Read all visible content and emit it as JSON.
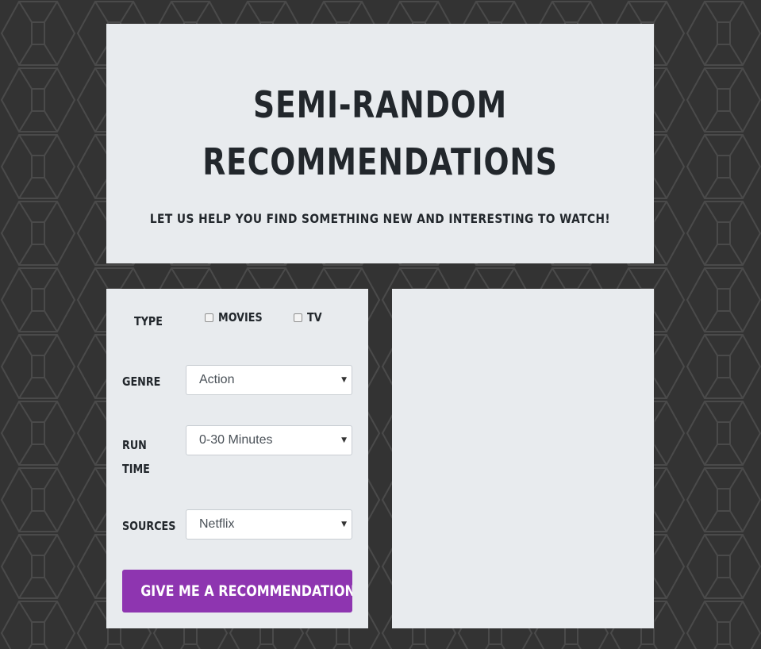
{
  "header": {
    "title_line1": "Semi-Random",
    "title_line2": "Recommendations",
    "subtitle": "Let us help you find something new and interesting to watch!"
  },
  "form": {
    "type": {
      "label": "Type",
      "options": [
        {
          "label": "Movies",
          "checked": false
        },
        {
          "label": "TV",
          "checked": false
        }
      ]
    },
    "genre": {
      "label": "Genre",
      "value": "Action"
    },
    "runtime": {
      "label_line1": "Run",
      "label_line2": "Time",
      "value": "0-30 Minutes"
    },
    "sources": {
      "label": "Sources",
      "value": "Netflix"
    },
    "submit_label": "Give me a recommendation!"
  },
  "icons": {
    "caret": "chevron-down-icon"
  },
  "colors": {
    "background": "#333333",
    "panel": "#e8ebee",
    "text": "#22272c",
    "accent": "#8e35b0"
  }
}
